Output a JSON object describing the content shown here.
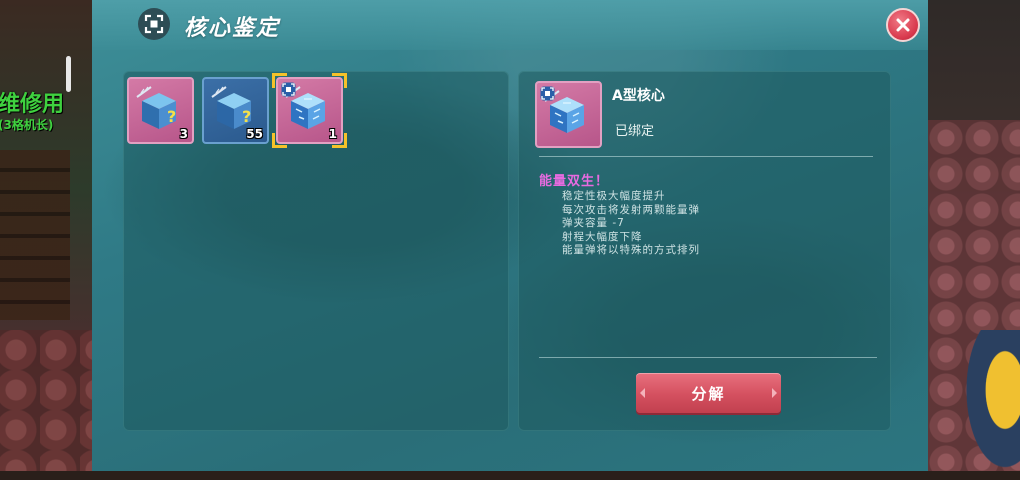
{
  "background": {
    "npc_name": "维修用",
    "npc_subtitle": "(3格机长)"
  },
  "dialog": {
    "title": "核心鉴定",
    "title_icon": "core-frame-icon",
    "close_icon": "close-x-icon"
  },
  "inventory": {
    "slots": [
      {
        "rarity": "pink",
        "count": "3",
        "icon": "mystery-cube-icon"
      },
      {
        "rarity": "blue",
        "count": "55",
        "icon": "mystery-cube-icon"
      },
      {
        "rarity": "pink",
        "count": "1",
        "icon": "blue-core-cube-icon",
        "selected": true,
        "type_mark": "core-type-icon"
      }
    ]
  },
  "detail": {
    "item_name": "A型核心",
    "status": "已绑定",
    "effect_title": "能量双生！",
    "effect_lines": [
      "稳定性极大幅度提升",
      "每次攻击将发射两颗能量弹",
      "弹夹容量 -7",
      "射程大幅度下降",
      "能量弹将以特殊的方式排列"
    ],
    "decompose_label": "分解"
  },
  "colors": {
    "accent_pink": "#e86be0",
    "button_red": "#d4505f",
    "selection_gold": "#f5c22a",
    "dialog_teal": "#2f7a86"
  }
}
